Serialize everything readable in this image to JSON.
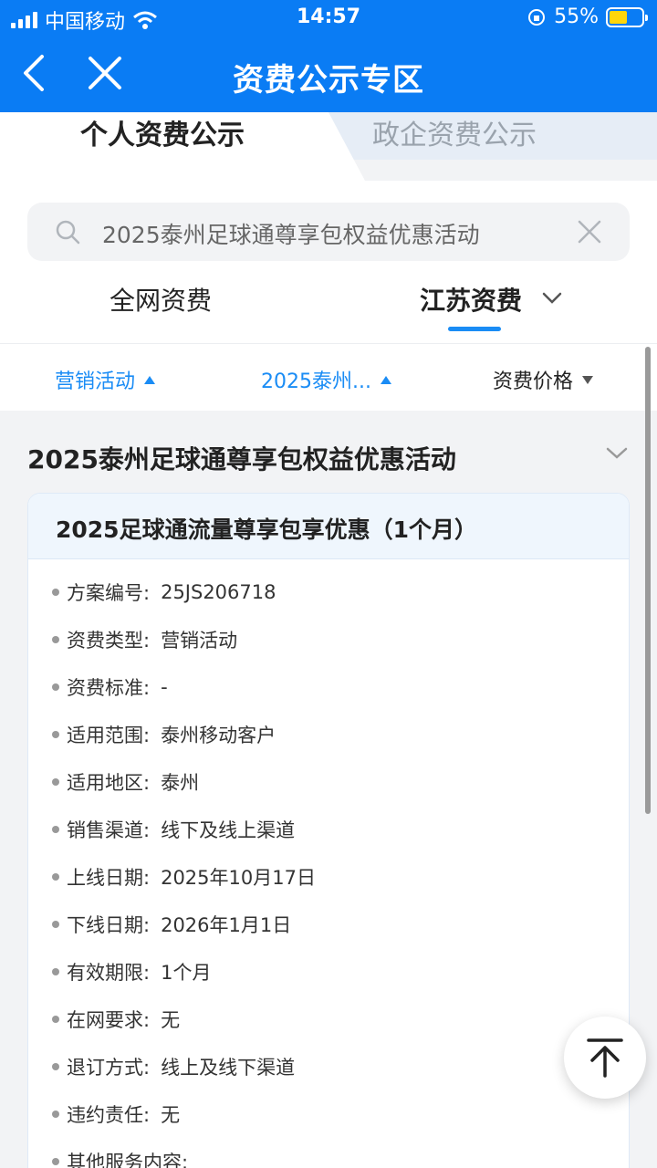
{
  "status_bar": {
    "carrier": "中国移动",
    "time": "14:57",
    "battery": "55%"
  },
  "nav": {
    "title": "资费公示专区"
  },
  "top_tabs": {
    "personal": "个人资费公示",
    "enterprise": "政企资费公示"
  },
  "search": {
    "value": "2025泰州足球通尊享包权益优惠活动"
  },
  "sub_tabs": {
    "all": "全网资费",
    "jiangsu": "江苏资费"
  },
  "filters": {
    "activity": "营销活动",
    "year": "2025泰州...",
    "price": "资费价格"
  },
  "section": {
    "title": "2025泰州足球通尊享包权益优惠活动"
  },
  "card": {
    "title": "2025足球通流量尊享包享优惠（1个月）",
    "rows": [
      {
        "label": "方案编号:",
        "value": "25JS206718"
      },
      {
        "label": "资费类型:",
        "value": "营销活动"
      },
      {
        "label": "资费标准:",
        "value": "-"
      },
      {
        "label": "适用范围:",
        "value": "泰州移动客户"
      },
      {
        "label": "适用地区:",
        "value": "泰州"
      },
      {
        "label": "销售渠道:",
        "value": "线下及线上渠道"
      },
      {
        "label": "上线日期:",
        "value": "2025年10月17日"
      },
      {
        "label": "下线日期:",
        "value": "2026年1月1日"
      },
      {
        "label": "有效期限:",
        "value": "1个月"
      },
      {
        "label": "在网要求:",
        "value": "无"
      },
      {
        "label": "退订方式:",
        "value": "线上及线下渠道"
      },
      {
        "label": "违约责任:",
        "value": "无"
      },
      {
        "label": "其他服务内容:",
        "value": ""
      }
    ]
  }
}
